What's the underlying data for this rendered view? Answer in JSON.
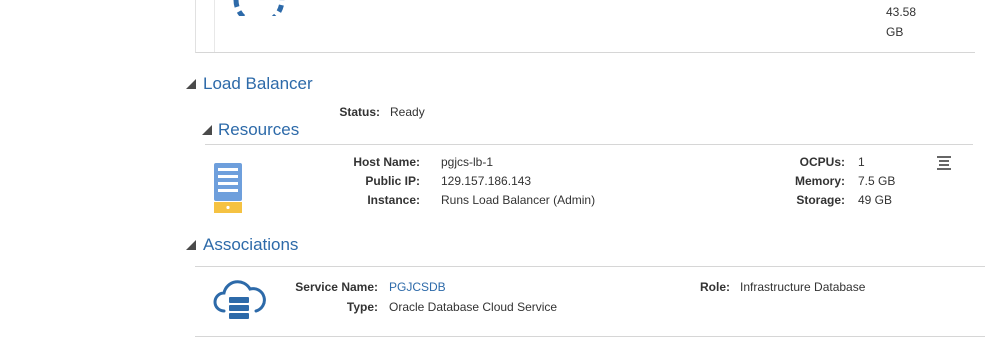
{
  "top_panel": {
    "storage_value": "43.58",
    "storage_unit": "GB"
  },
  "load_balancer": {
    "title": "Load Balancer",
    "status_label": "Status:",
    "status_value": "Ready"
  },
  "resources": {
    "title": "Resources",
    "host_name_label": "Host Name:",
    "host_name_value": "pgjcs-lb-1",
    "public_ip_label": "Public IP:",
    "public_ip_value": "129.157.186.143",
    "instance_label": "Instance:",
    "instance_value": "Runs Load Balancer (Admin)",
    "ocpus_label": "OCPUs:",
    "ocpus_value": "1",
    "memory_label": "Memory:",
    "memory_value": "7.5 GB",
    "storage_label": "Storage:",
    "storage_value": "49 GB"
  },
  "associations": {
    "title": "Associations",
    "service_name_label": "Service Name:",
    "service_name_value": "PGJCSDB",
    "type_label": "Type:",
    "type_value": "Oracle Database Cloud Service",
    "role_label": "Role:",
    "role_value": "Infrastructure Database"
  },
  "colors": {
    "accent": "#2d6aa9",
    "text": "#333333",
    "divider": "#d6d6d6",
    "server_icon": "#6e9fdc",
    "server_base": "#f5c242"
  },
  "icons": {
    "spinner": "loading-spinner-icon",
    "server": "server-icon",
    "menu": "menu-lines-icon",
    "cloud_db": "cloud-database-icon",
    "collapse": "collapse-triangle-icon"
  }
}
